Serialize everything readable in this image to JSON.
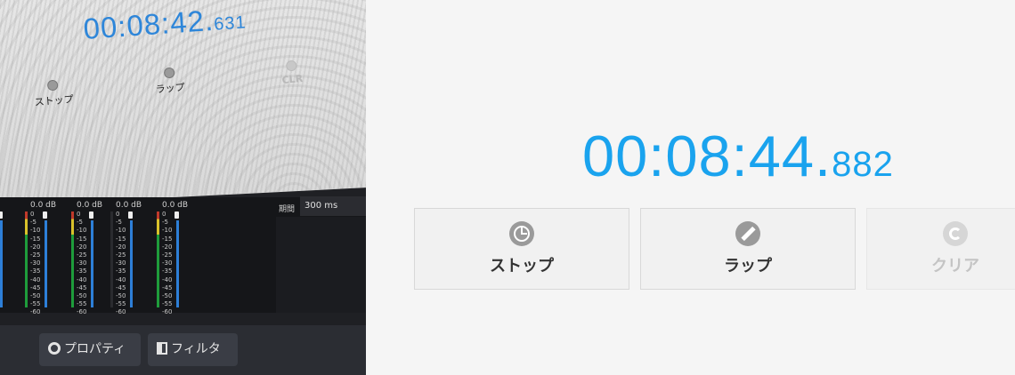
{
  "obs": {
    "preview": {
      "clock_main": "00:08:42.",
      "clock_ms": "631",
      "stop_label": "ストップ",
      "lap_label": "ラップ",
      "clear_label": "CLR"
    },
    "mixer": {
      "channels": [
        {
          "db": "",
          "bar": "a"
        },
        {
          "db": "0.0 dB",
          "bar": "a"
        },
        {
          "db": "0.0 dB",
          "bar": "a"
        },
        {
          "db": "0.0 dB",
          "bar": "g"
        },
        {
          "db": "0.0 dB",
          "bar": "a"
        }
      ],
      "ticks": [
        "0",
        "-5",
        "-10",
        "-15",
        "-20",
        "-25",
        "-30",
        "-35",
        "-40",
        "-45",
        "-50",
        "-55",
        "-60"
      ],
      "period_label": "期間",
      "period_value": "300 ms"
    },
    "toolbar": {
      "properties_label": "プロパティ",
      "filter_label": "フィルタ"
    }
  },
  "stopwatch": {
    "time_main": "00:08:44.",
    "time_ms": "882",
    "buttons": {
      "stop": "ストップ",
      "lap": "ラップ",
      "clear": "クリア"
    }
  },
  "colors": {
    "accent": "#1aa3ee",
    "preview_clock": "#2e86d9",
    "obs_background": "#1f2024",
    "disabled_text": "#c4c4c4"
  },
  "icons": {
    "stop": "clock-icon",
    "lap": "pencil-icon",
    "clear": "refresh-icon",
    "properties": "gear-icon",
    "filter": "filter-icon"
  }
}
